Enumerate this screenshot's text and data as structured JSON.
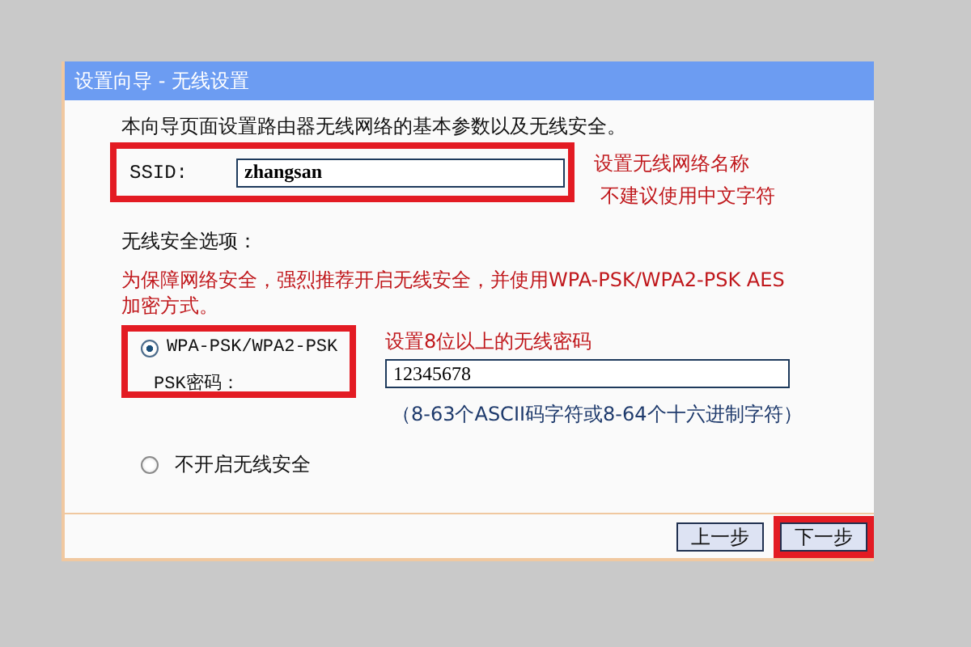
{
  "window": {
    "title": "设置向导 - 无线设置"
  },
  "intro": "本向导页面设置路由器无线网络的基本参数以及无线安全。",
  "ssid": {
    "label": "SSID:",
    "value": "zhangsan",
    "highlighted": true,
    "notes": [
      "设置无线网络名称",
      "不建议使用中文字符"
    ]
  },
  "security": {
    "heading": "无线安全选项：",
    "warning": "为保障网络安全，强烈推荐开启无线安全，并使用WPA-PSK/WPA2-PSK AES加密方式。",
    "options": [
      {
        "kind": "psk",
        "label": "WPA-PSK/WPA2-PSK",
        "selected": true,
        "highlighted": true,
        "password_label": "PSK密码：",
        "password": "12345678",
        "note": "设置8位以上的无线密码",
        "hint": "（8-63个ASCII码字符或8-64个十六进制字符）"
      },
      {
        "kind": "plain",
        "label": "不开启无线安全",
        "selected": false
      }
    ]
  },
  "buttons": [
    {
      "label": "上一步",
      "highlighted": false
    },
    {
      "label": "下一步",
      "highlighted": true
    }
  ]
}
